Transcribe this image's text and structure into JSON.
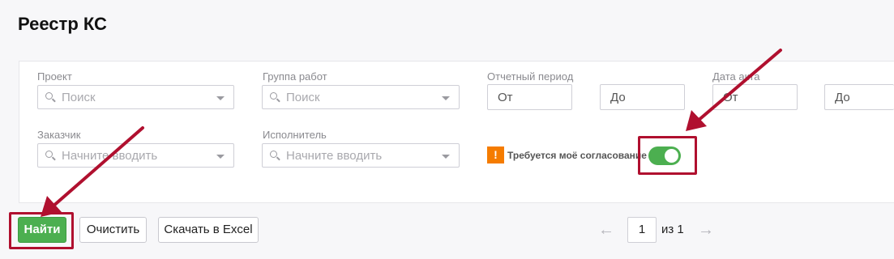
{
  "page": {
    "title": "Реестр КС"
  },
  "filters": {
    "project": {
      "label": "Проект",
      "placeholder": "Поиск"
    },
    "work_group": {
      "label": "Группа работ",
      "placeholder": "Поиск"
    },
    "report_period": {
      "label": "Отчетный период",
      "from": "От",
      "to": "До"
    },
    "act_date": {
      "label": "Дата акта",
      "from": "От",
      "to": "До"
    },
    "customer": {
      "label": "Заказчик",
      "placeholder": "Начните вводить"
    },
    "contractor": {
      "label": "Исполнитель",
      "placeholder": "Начните вводить"
    },
    "approval_toggle": {
      "label": "Требуется моё согласование",
      "warning_glyph": "!",
      "enabled": true
    }
  },
  "actions": {
    "find": "Найти",
    "clear": "Очистить",
    "export": "Скачать в Excel"
  },
  "pagination": {
    "prev_glyph": "←",
    "next_glyph": "→",
    "current": "1",
    "total": "из 1"
  },
  "colors": {
    "accent_green": "#4caf50",
    "warning_orange": "#f57c00",
    "annotation_red": "#b0102f"
  }
}
